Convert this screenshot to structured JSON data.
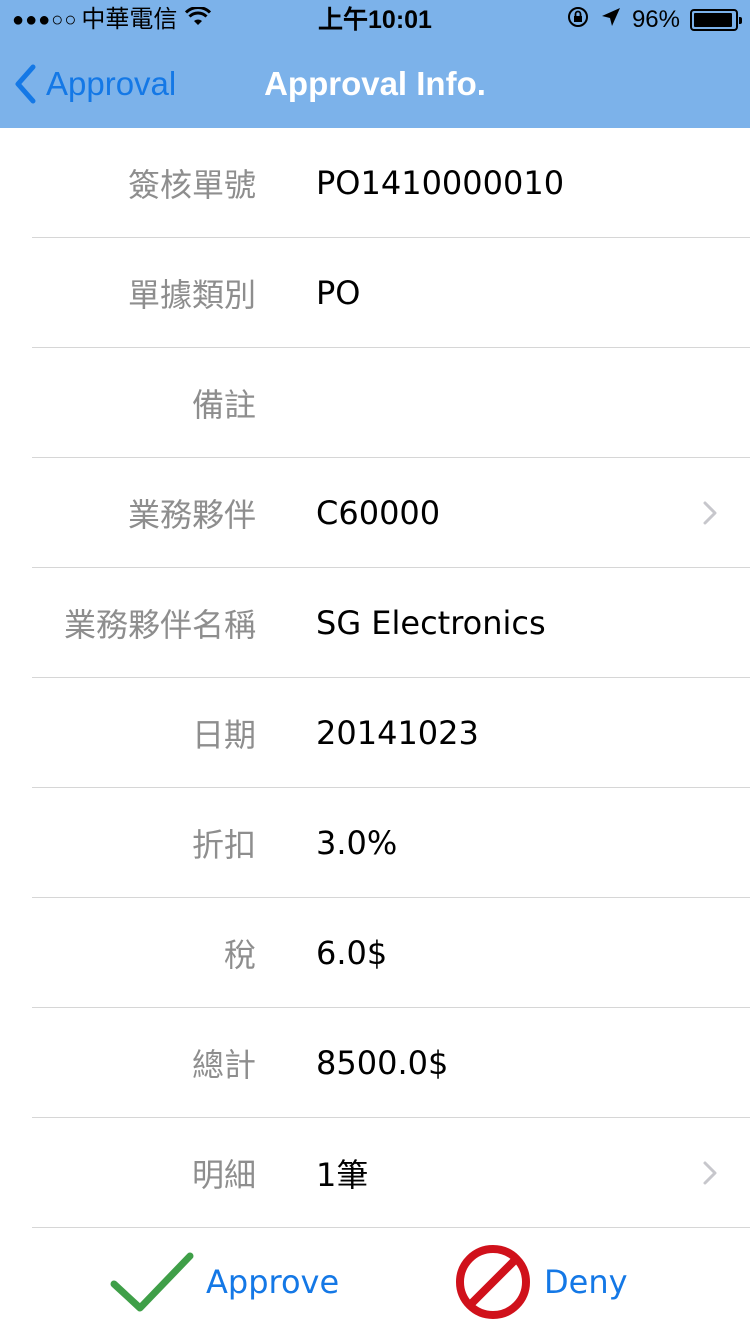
{
  "status_bar": {
    "signal": "●●●○○",
    "carrier": "中華電信",
    "time": "上午10:01",
    "battery_percent": "96%",
    "battery_level": 0.96
  },
  "nav": {
    "back_label": "Approval",
    "title": "Approval Info."
  },
  "rows": [
    {
      "label": "簽核單號",
      "value": "PO1410000010"
    },
    {
      "label": "單據類別",
      "value": "PO"
    },
    {
      "label": "備註",
      "value": ""
    },
    {
      "label": "業務夥伴",
      "value": "C60000"
    },
    {
      "label": "業務夥伴名稱",
      "value": "SG Electronics"
    },
    {
      "label": "日期",
      "value": "20141023"
    },
    {
      "label": "折扣",
      "value": "3.0%"
    },
    {
      "label": "稅",
      "value": "6.0$"
    },
    {
      "label": "總計",
      "value": "8500.0$"
    },
    {
      "label": "明細",
      "value": "1筆"
    }
  ],
  "actions": {
    "approve_label": "Approve",
    "deny_label": "Deny"
  },
  "colors": {
    "nav_background": "#7cb2ea",
    "accent": "#1478e6",
    "approve_check": "#3f9f48",
    "deny_sign": "#d0111b"
  },
  "icons": [
    "wifi-icon",
    "rotation-lock-icon",
    "location-arrow-icon",
    "battery-icon",
    "back-chevron-icon",
    "disclosure-chevron-icon",
    "checkmark-icon",
    "no-entry-icon"
  ]
}
